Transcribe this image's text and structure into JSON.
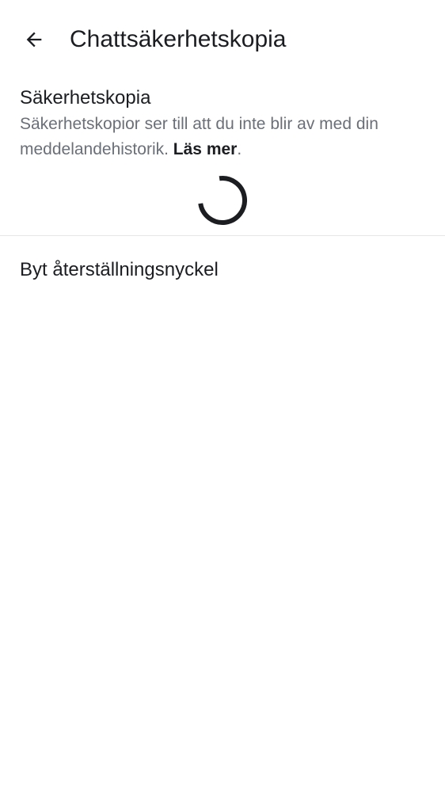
{
  "header": {
    "title": "Chattsäkerhetskopia",
    "back_icon": "arrow-back-icon"
  },
  "backup": {
    "title": "Säkerhetskopia",
    "description": "Säkerhetskopior ser till att du inte blir av med din meddelandehistorik.",
    "learn_more": "Läs mer",
    "learn_more_suffix": ".",
    "spinner_icon": "loading-spinner-icon"
  },
  "actions": {
    "change_recovery_key": "Byt återställningsnyckel"
  },
  "colors": {
    "text_primary": "#1b1d21",
    "text_secondary": "#6b6f78",
    "divider": "#e6e7ea",
    "background": "#ffffff"
  }
}
